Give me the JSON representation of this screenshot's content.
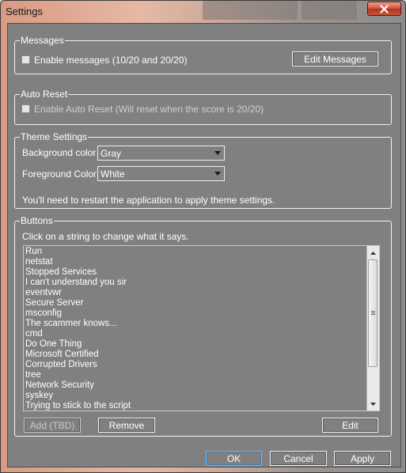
{
  "window": {
    "title": "Settings"
  },
  "messages": {
    "legend": "Messages",
    "enable_label": "Enable messages (10/20 and 20/20)",
    "enable_checked": false,
    "edit_button": "Edit Messages"
  },
  "auto_reset": {
    "legend": "Auto Reset",
    "enable_label": "Enable Auto Reset (Will reset when the score is 20/20)",
    "enable_checked": false
  },
  "theme": {
    "legend": "Theme Settings",
    "background_label": "Background color",
    "background_value": "Gray",
    "foreground_label": "Foreground Color",
    "foreground_value": "White",
    "note": "You'll need to restart the application to apply theme settings."
  },
  "buttons": {
    "legend": "Buttons",
    "hint": "Click on a string to change what it says.",
    "items": [
      "Run",
      "netstat",
      "Stopped Services",
      "I can't understand you sir",
      "eventvwr",
      "Secure Server",
      "msconfig",
      "The scammer knows...",
      "cmd",
      "Do One Thing",
      "Microsoft Certified",
      "Corrupted Drivers",
      "tree",
      "Network Security",
      "syskey",
      "Trying to stick to the script"
    ],
    "add_button": "Add (TBD)",
    "remove_button": "Remove",
    "edit_button": "Edit"
  },
  "footer": {
    "ok": "OK",
    "cancel": "Cancel",
    "apply": "Apply"
  },
  "icons": {
    "close": "close-icon",
    "dropdown": "chevron-down-icon",
    "scroll_up": "scroll-up-arrow-icon",
    "scroll_down": "scroll-down-arrow-icon"
  },
  "colors": {
    "client_background": "#808080",
    "text": "#ffffff",
    "border": "#f2f2f2",
    "close_button": "#c8553f"
  }
}
